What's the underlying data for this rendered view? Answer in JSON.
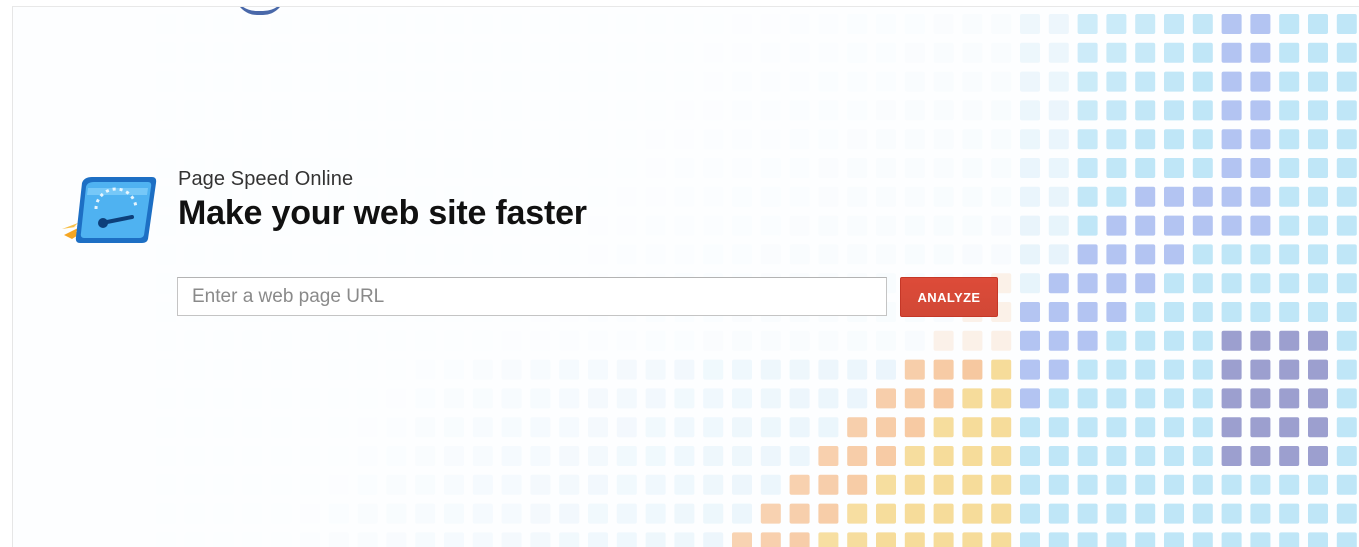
{
  "app": {
    "product_name": "Page Speed Online",
    "title": "Make your web site faster"
  },
  "form": {
    "url_placeholder": "Enter a web page URL",
    "url_value": "",
    "analyze_label": "ANALYZE"
  },
  "icons": {
    "logo": "speedometer-folder-icon"
  },
  "colors": {
    "accent": "#d14836",
    "logo_blue": "#2f8fe0",
    "logo_flame": "#f5a623",
    "mosaic_blue": "#bfe6f7",
    "mosaic_periwinkle": "#b3c4f2",
    "mosaic_indigo": "#9c9fcf",
    "mosaic_orange": "#f6c69c",
    "mosaic_yellow": "#f6dc9a"
  }
}
